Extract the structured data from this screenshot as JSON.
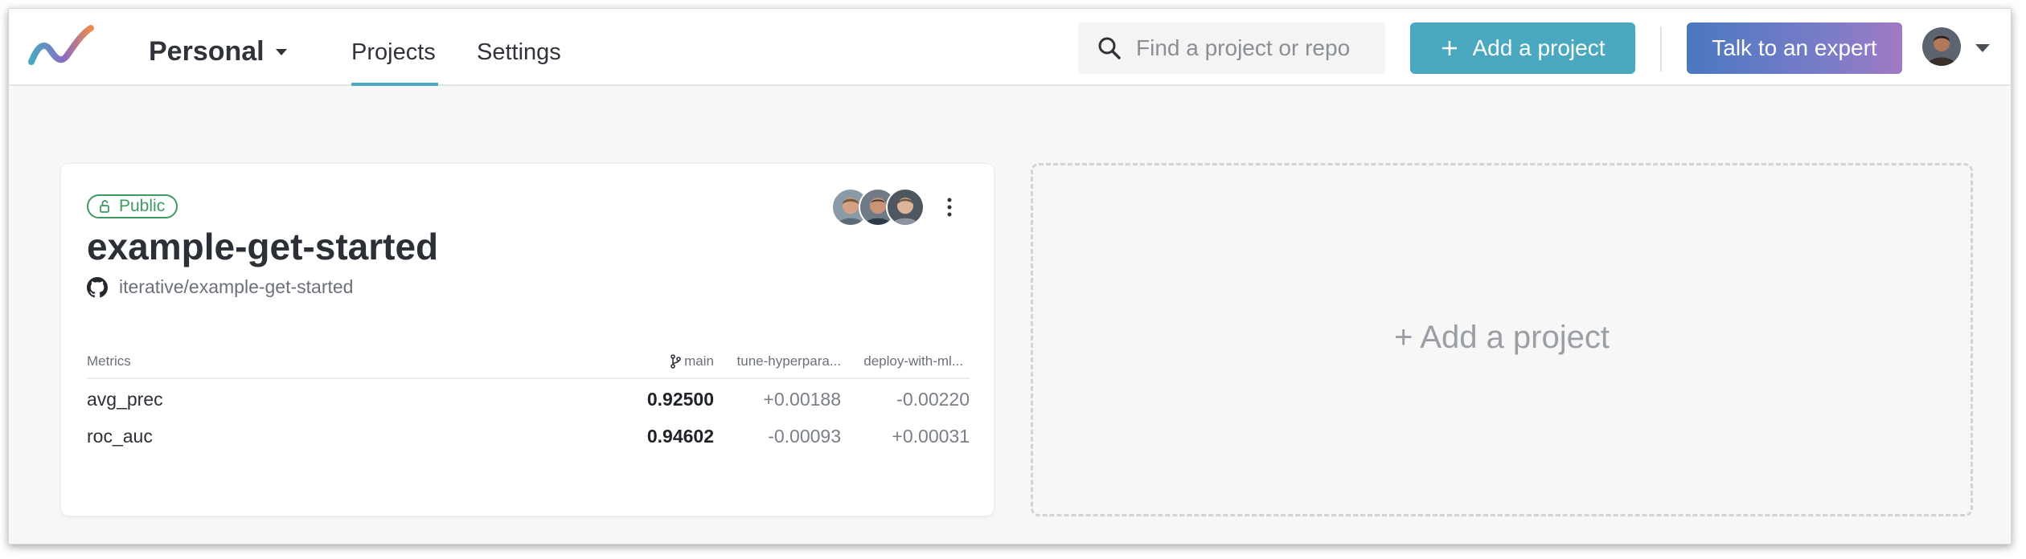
{
  "header": {
    "workspace": "Personal",
    "tabs": [
      {
        "label": "Projects",
        "active": true
      },
      {
        "label": "Settings",
        "active": false
      }
    ],
    "search_placeholder": "Find a project or repo",
    "add_project_button": "Add a project",
    "expert_button": "Talk to an expert",
    "accent_color": "#4aa8c0"
  },
  "project": {
    "visibility": "Public",
    "title": "example-get-started",
    "repo": "iterative/example-get-started",
    "metrics": {
      "header": "Metrics",
      "columns": [
        "main",
        "tune-hyperpara...",
        "deploy-with-ml..."
      ],
      "rows": [
        {
          "name": "avg_prec",
          "main": "0.92500",
          "d1": "+0.00188",
          "d2": "-0.00220"
        },
        {
          "name": "roc_auc",
          "main": "0.94602",
          "d1": "-0.00093",
          "d2": "+0.00031"
        }
      ]
    }
  },
  "add_card": {
    "label": "+ Add a project"
  }
}
